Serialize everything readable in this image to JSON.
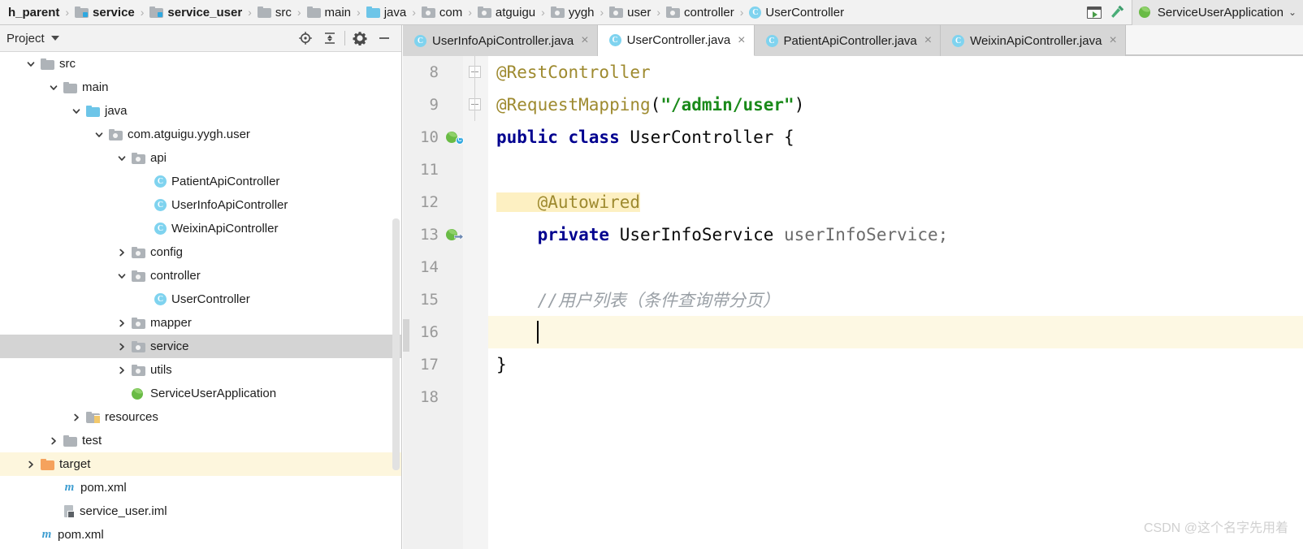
{
  "navbar": {
    "breadcrumb": [
      {
        "label": "h_parent",
        "icon": "none",
        "bold": true
      },
      {
        "label": "service",
        "icon": "folder-module-icon",
        "bold": true
      },
      {
        "label": "service_user",
        "icon": "folder-module-icon",
        "bold": true
      },
      {
        "label": "src",
        "icon": "folder-icon",
        "bold": false
      },
      {
        "label": "main",
        "icon": "folder-icon",
        "bold": false
      },
      {
        "label": "java",
        "icon": "folder-source-icon",
        "bold": false
      },
      {
        "label": "com",
        "icon": "folder-package-icon",
        "bold": false
      },
      {
        "label": "atguigu",
        "icon": "folder-package-icon",
        "bold": false
      },
      {
        "label": "yygh",
        "icon": "folder-package-icon",
        "bold": false
      },
      {
        "label": "user",
        "icon": "folder-package-icon",
        "bold": false
      },
      {
        "label": "controller",
        "icon": "folder-package-icon",
        "bold": false
      },
      {
        "label": "UserController",
        "icon": "java-class-icon",
        "bold": false
      }
    ],
    "separator": "›",
    "run_config": {
      "label": "ServiceUserApplication",
      "chevron": "⌄"
    },
    "icons": {
      "select_run_config": "run-configurations-icon",
      "build": "build-hammer-icon"
    }
  },
  "project_panel": {
    "title": "Project",
    "toolbar_icons": [
      "scroll-from-source-icon",
      "collapse-all-icon",
      "settings-gear-icon",
      "hide-panel-icon"
    ],
    "tree": [
      {
        "label": "src",
        "indent": 1,
        "arrow": "down",
        "icon": "folder-icon",
        "state": "normal"
      },
      {
        "label": "main",
        "indent": 2,
        "arrow": "down",
        "icon": "folder-icon",
        "state": "normal"
      },
      {
        "label": "java",
        "indent": 3,
        "arrow": "down",
        "icon": "folder-source-icon",
        "state": "normal"
      },
      {
        "label": "com.atguigu.yygh.user",
        "indent": 4,
        "arrow": "down",
        "icon": "folder-package-icon",
        "state": "normal"
      },
      {
        "label": "api",
        "indent": 5,
        "arrow": "down",
        "icon": "folder-package-icon",
        "state": "normal"
      },
      {
        "label": "PatientApiController",
        "indent": 6,
        "arrow": "none",
        "icon": "java-class-icon",
        "state": "normal"
      },
      {
        "label": "UserInfoApiController",
        "indent": 6,
        "arrow": "none",
        "icon": "java-class-icon",
        "state": "normal"
      },
      {
        "label": "WeixinApiController",
        "indent": 6,
        "arrow": "none",
        "icon": "java-class-icon",
        "state": "normal"
      },
      {
        "label": "config",
        "indent": 5,
        "arrow": "right",
        "icon": "folder-package-icon",
        "state": "normal"
      },
      {
        "label": "controller",
        "indent": 5,
        "arrow": "down",
        "icon": "folder-package-icon",
        "state": "normal"
      },
      {
        "label": "UserController",
        "indent": 6,
        "arrow": "none",
        "icon": "java-class-icon",
        "state": "normal"
      },
      {
        "label": "mapper",
        "indent": 5,
        "arrow": "right",
        "icon": "folder-package-icon",
        "state": "normal"
      },
      {
        "label": "service",
        "indent": 5,
        "arrow": "right",
        "icon": "folder-package-icon",
        "state": "selected"
      },
      {
        "label": "utils",
        "indent": 5,
        "arrow": "right",
        "icon": "folder-package-icon",
        "state": "normal"
      },
      {
        "label": "ServiceUserApplication",
        "indent": 5,
        "arrow": "none",
        "icon": "spring-boot-icon",
        "state": "normal"
      },
      {
        "label": "resources",
        "indent": 3,
        "arrow": "right",
        "icon": "folder-resources-icon",
        "state": "normal"
      },
      {
        "label": "test",
        "indent": 2,
        "arrow": "right",
        "icon": "folder-icon",
        "state": "normal"
      },
      {
        "label": "target",
        "indent": 1,
        "arrow": "right",
        "icon": "folder-target-icon",
        "state": "highlight"
      },
      {
        "label": "pom.xml",
        "indent": 2,
        "arrow": "none",
        "icon": "maven-icon",
        "state": "normal"
      },
      {
        "label": "service_user.iml",
        "indent": 2,
        "arrow": "none",
        "icon": "iml-module-icon",
        "state": "normal"
      },
      {
        "label": "pom.xml",
        "indent": 1,
        "arrow": "none",
        "icon": "maven-icon",
        "state": "normal"
      }
    ]
  },
  "editor": {
    "tabs": [
      {
        "label": "UserInfoApiController.java",
        "icon": "java-class-icon",
        "active": false,
        "close": "×"
      },
      {
        "label": "UserController.java",
        "icon": "java-class-icon",
        "active": true,
        "close": "×"
      },
      {
        "label": "PatientApiController.java",
        "icon": "java-class-icon",
        "active": false,
        "close": "×"
      },
      {
        "label": "WeixinApiController.java",
        "icon": "java-class-icon",
        "active": false,
        "close": "×"
      }
    ],
    "lines": [
      {
        "number": "8",
        "gutter_icon": "none",
        "fold": "collapse",
        "active": false,
        "segments": [
          {
            "text": "@RestController",
            "kind": "annotation"
          }
        ]
      },
      {
        "number": "9",
        "gutter_icon": "none",
        "fold": "collapse",
        "active": false,
        "segments": [
          {
            "text": "@RequestMapping",
            "kind": "annotation"
          },
          {
            "text": "(",
            "kind": "plain"
          },
          {
            "text": "\"/admin/user\"",
            "kind": "string"
          },
          {
            "text": ")",
            "kind": "plain"
          }
        ]
      },
      {
        "number": "10",
        "gutter_icon": "spring-bean-class-icon",
        "fold": "none",
        "active": false,
        "segments": [
          {
            "text": "public class ",
            "kind": "keyword"
          },
          {
            "text": "UserController {",
            "kind": "plain"
          }
        ]
      },
      {
        "number": "11",
        "gutter_icon": "none",
        "fold": "none",
        "active": false,
        "segments": []
      },
      {
        "number": "12",
        "gutter_icon": "none",
        "fold": "none",
        "active": false,
        "segments": [
          {
            "text": "    @Autowired",
            "kind": "annotation-highlighted"
          }
        ]
      },
      {
        "number": "13",
        "gutter_icon": "spring-bean-autowired-icon",
        "fold": "none",
        "active": false,
        "segments": [
          {
            "text": "    ",
            "kind": "plain"
          },
          {
            "text": "private ",
            "kind": "keyword"
          },
          {
            "text": "UserInfoService ",
            "kind": "plain"
          },
          {
            "text": "userInfoService;",
            "kind": "field"
          }
        ]
      },
      {
        "number": "14",
        "gutter_icon": "none",
        "fold": "none",
        "active": false,
        "segments": []
      },
      {
        "number": "15",
        "gutter_icon": "none",
        "fold": "none",
        "active": false,
        "segments": [
          {
            "text": "    //用户列表（条件查询带分页）",
            "kind": "comment"
          }
        ]
      },
      {
        "number": "16",
        "gutter_icon": "none",
        "fold": "none",
        "active": true,
        "caret": true,
        "segments": [
          {
            "text": "    ",
            "kind": "plain"
          }
        ]
      },
      {
        "number": "17",
        "gutter_icon": "none",
        "fold": "none",
        "active": false,
        "segments": [
          {
            "text": "}",
            "kind": "plain"
          }
        ]
      },
      {
        "number": "18",
        "gutter_icon": "none",
        "fold": "none",
        "active": false,
        "segments": []
      }
    ]
  },
  "watermark": {
    "text": "CSDN @这个名字先用着"
  },
  "colors": {
    "annotation": "#9e8a2f",
    "keyword": "#00008f",
    "string": "#1a8a1a",
    "comment": "#9aa0a6",
    "active_line": "#fdf8e3",
    "selection": "#d4d4d4",
    "highlight_row": "#fdf6dd",
    "class_icon": "#7fd3ef",
    "spring_green": "#69bb45",
    "folder_blue": "#6dc5e8",
    "folder_orange": "#f5a25d"
  }
}
